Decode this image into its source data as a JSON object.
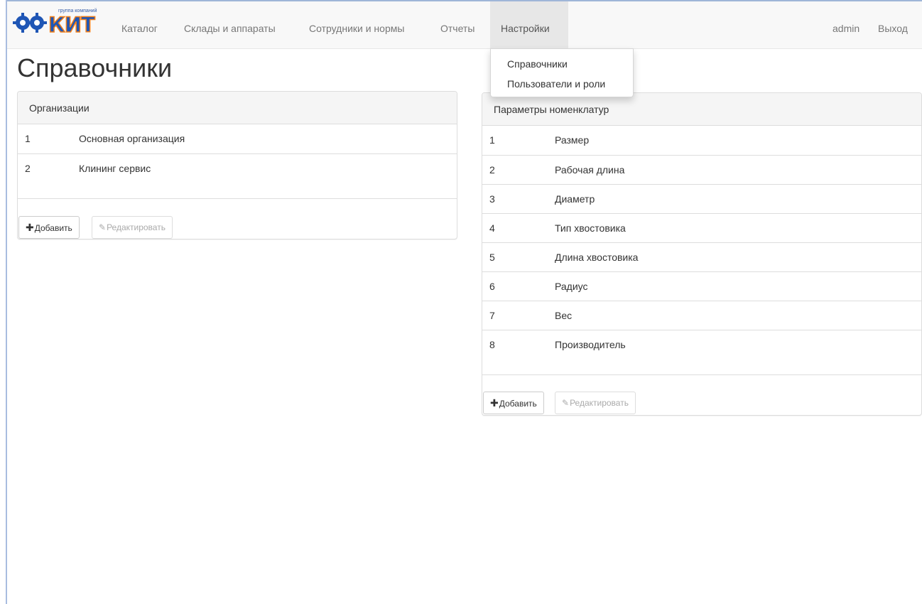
{
  "brand": {
    "logo_text": "РСКИТ",
    "tagline": "группа компаний",
    "colors": {
      "blue": "#1f56b5",
      "orange": "#f07f1a"
    }
  },
  "navbar": {
    "items": [
      {
        "label": "Каталог"
      },
      {
        "label": "Склады и аппараты"
      },
      {
        "label": "Сотрудники и нормы"
      },
      {
        "label": "Отчеты"
      },
      {
        "label": "Настройки",
        "active": true
      }
    ],
    "user": "admin",
    "logout": "Выход"
  },
  "dropdown": {
    "items": [
      {
        "label": "Справочники"
      },
      {
        "label": "Пользователи и роли"
      }
    ]
  },
  "page": {
    "title": "Справочники"
  },
  "organizations": {
    "title": "Организации",
    "rows": [
      {
        "num": "1",
        "name": "Основная организация"
      },
      {
        "num": "2",
        "name": "Клининг сервис"
      }
    ],
    "add_label": "Добавить",
    "edit_label": "Редактировать"
  },
  "parameters": {
    "title": "Параметры номенклатур",
    "rows": [
      {
        "num": "1",
        "name": "Размер"
      },
      {
        "num": "2",
        "name": "Рабочая длина"
      },
      {
        "num": "3",
        "name": "Диаметр"
      },
      {
        "num": "4",
        "name": "Тип хвостовика"
      },
      {
        "num": "5",
        "name": "Длина хвостовика"
      },
      {
        "num": "6",
        "name": "Радиус"
      },
      {
        "num": "7",
        "name": "Вес"
      },
      {
        "num": "8",
        "name": "Производитель"
      }
    ],
    "add_label": "Добавить",
    "edit_label": "Редактировать"
  },
  "icons": {
    "add": "plus-icon",
    "edit": "pencil-icon"
  }
}
